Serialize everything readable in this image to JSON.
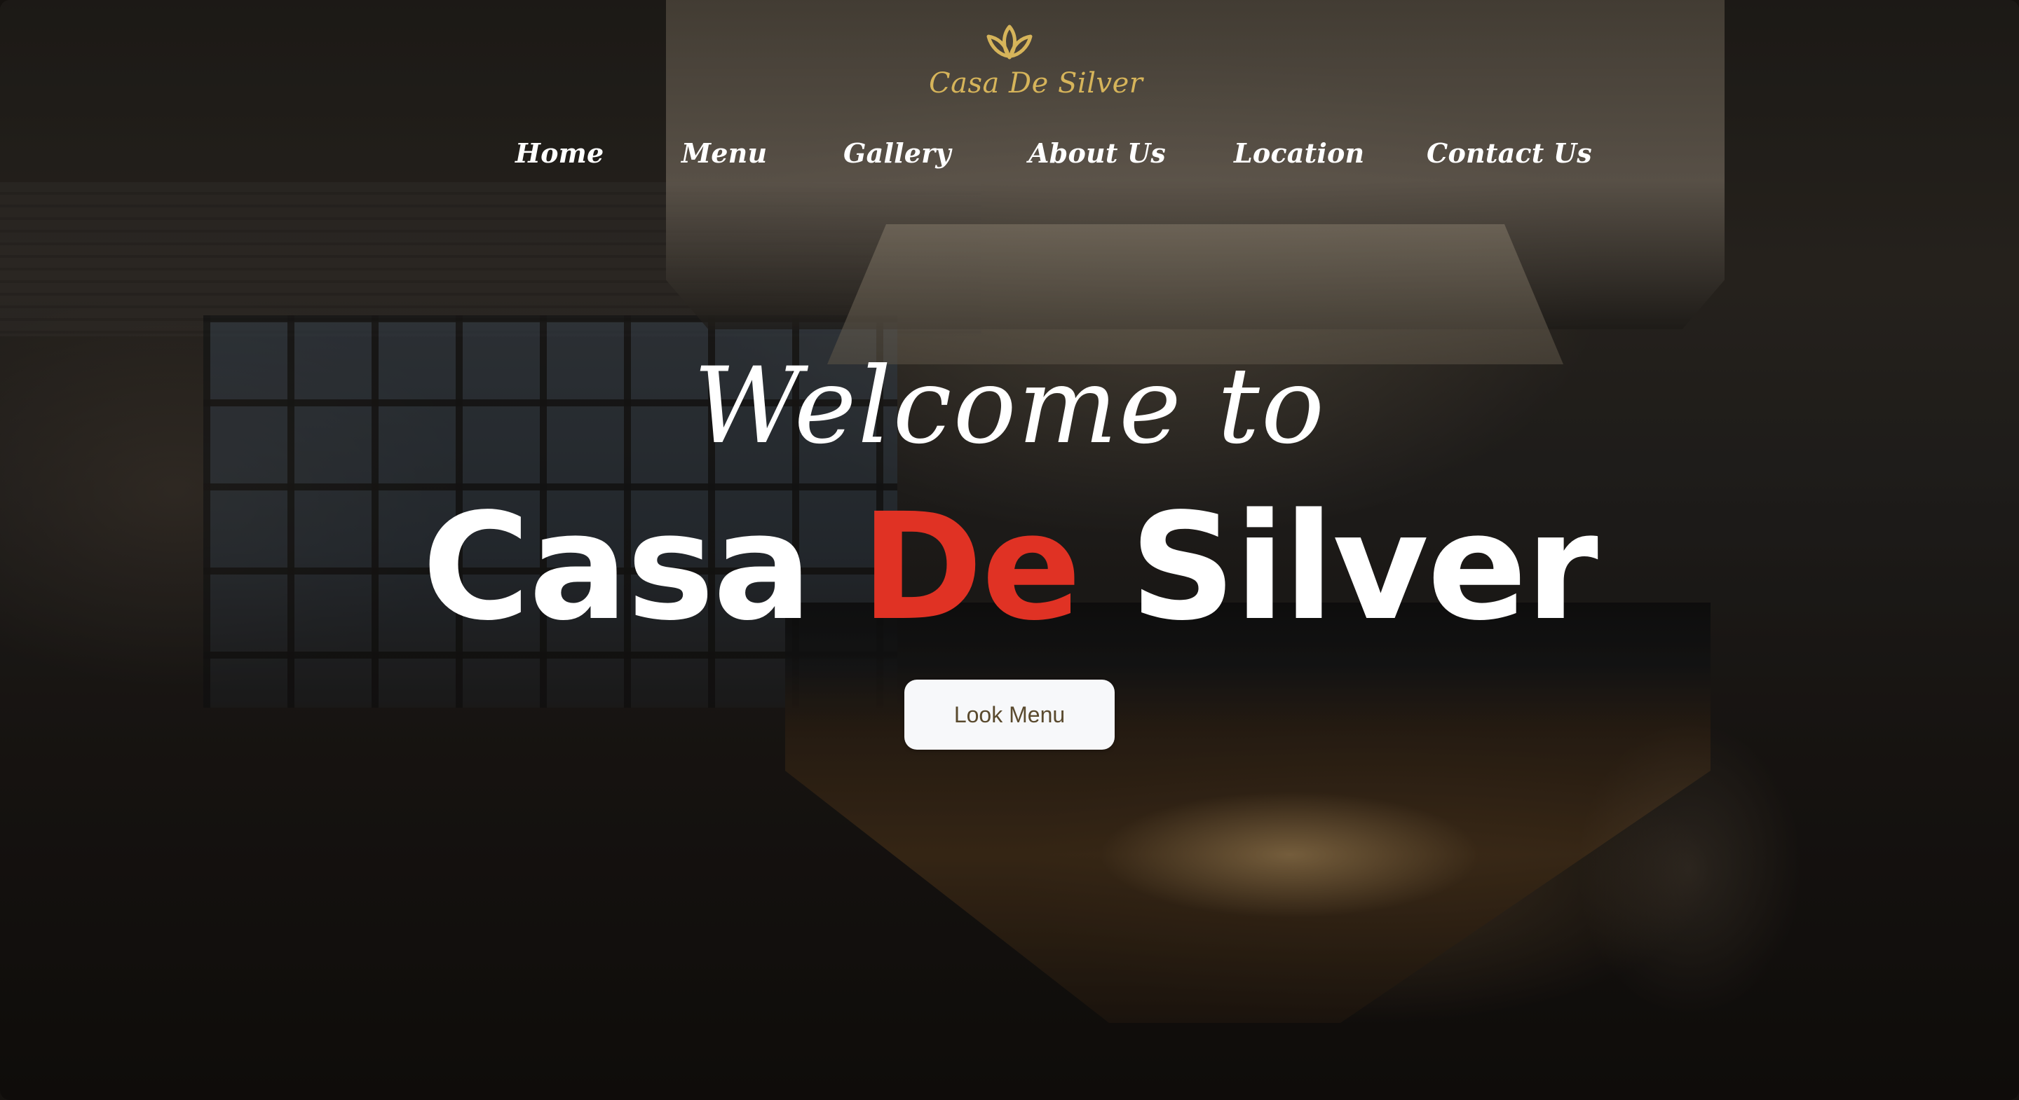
{
  "brand": {
    "logo_text": "Casa De Silver",
    "logo_icon": "lotus-icon",
    "logo_color": "#d6b45a"
  },
  "nav": {
    "items": [
      {
        "label": "Home"
      },
      {
        "label": "Menu"
      },
      {
        "label": "Gallery"
      },
      {
        "label": "About Us"
      },
      {
        "label": "Location"
      },
      {
        "label": "Contact Us"
      }
    ]
  },
  "hero": {
    "welcome": "Welcome to",
    "title_part1": "Casa",
    "title_part2": "De",
    "title_part3": "Silver",
    "accent_color": "#e03224",
    "cta_label": "Look Menu"
  }
}
